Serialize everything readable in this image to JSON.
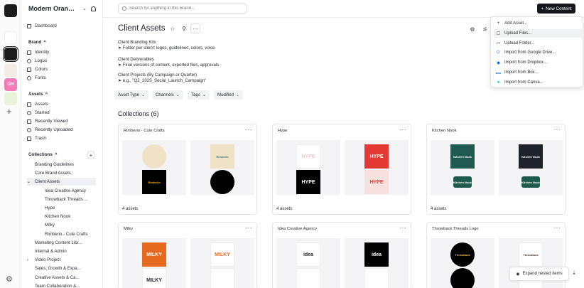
{
  "workspace": {
    "brand_name": "Modern Orange ...",
    "rail": [
      {
        "initials": "",
        "color": "#1c1c1c"
      },
      {
        "initials": "",
        "color": "#ffffff"
      },
      {
        "initials": "",
        "color": "#1c1c1c"
      },
      {
        "initials": "",
        "color": "#f2ede2"
      },
      {
        "initials": "GH",
        "color": "#f27cb8"
      },
      {
        "initials": "",
        "color": "#eaf3d8"
      }
    ]
  },
  "sidebar": {
    "dashboard": "Dashboard",
    "brand_header": "Brand",
    "brand_items": [
      "Identity",
      "Logos",
      "Colors",
      "Fonts"
    ],
    "assets_header": "Assets",
    "assets_items": [
      "Assets",
      "Starred",
      "Recently Viewed",
      "Recently Uploaded",
      "Trash"
    ],
    "collections_header": "Collections",
    "collections_items": [
      {
        "label": "Branding Guidelines"
      },
      {
        "label": "Core Brand Assets"
      },
      {
        "label": "Client Assets"
      },
      {
        "label": "Idea Creative Agency"
      },
      {
        "label": "Throwback Threads ..."
      },
      {
        "label": "Hype"
      },
      {
        "label": "Kitchen Nook"
      },
      {
        "label": "Milky"
      },
      {
        "label": "Rimberio - Cute Crafts"
      },
      {
        "label": "Marketing Content Libr..."
      },
      {
        "label": "Internal & Admin"
      },
      {
        "label": "Video Project"
      },
      {
        "label": "Sales, Growth & Expa..."
      },
      {
        "label": "Creative Assets & Ca..."
      },
      {
        "label": "Team Collaboration &..."
      }
    ]
  },
  "topbar": {
    "search_placeholder": "Search for anything in this Brand...",
    "new_content": "New Content"
  },
  "page": {
    "title": "Client Assets",
    "description": [
      "Client Branding Kits",
      "➤ Folder per client: logos, guidelines, colors, voice",
      "Client Deliverables",
      "➤ Final versions of content, exported files, approvals",
      "Client Projects (By Campaign or Quarter)",
      "➤ e.g., \"Q2_2025_Social_Launch_Campaign\""
    ],
    "filters": [
      "Asset Type",
      "Channels",
      "Tags",
      "Modified"
    ],
    "collections_title": "Collections (6)"
  },
  "collections": [
    {
      "name": "Rimberio - Cute Crafts",
      "count": "4 assets",
      "thumbs": [
        {
          "bg": "#f0e2c6",
          "fg": "#e0683a",
          "text": "",
          "shape": "circle"
        },
        {
          "bg": "#f0e2c6",
          "fg": "#3f7f73",
          "text": "Rimberio",
          "shape": "rect"
        },
        {
          "bg": "#000000",
          "fg": "#f5b400",
          "text": "Rimberio",
          "shape": "rect"
        },
        {
          "bg": "#000000",
          "fg": "#f15a24",
          "text": "",
          "shape": "circle"
        }
      ]
    },
    {
      "name": "Hype",
      "count": "4 assets",
      "thumbs": [
        {
          "bg": "#ffffff",
          "fg": "#f3c7c7",
          "text": "HYPE",
          "shape": "rect"
        },
        {
          "bg": "#e53935",
          "fg": "#ffffff",
          "text": "HYPE",
          "shape": "rect"
        },
        {
          "bg": "#000000",
          "fg": "#ffffff",
          "text": "HYPE",
          "shape": "rect"
        },
        {
          "bg": "#f6e1de",
          "fg": "#e53935",
          "text": "HYPE",
          "shape": "rect"
        }
      ]
    },
    {
      "name": "Kitchen Nook",
      "count": "4 assets",
      "thumbs": [
        {
          "bg": "#1e5a4e",
          "fg": "#ffffff",
          "text": "Kitchen Nook",
          "shape": "rect"
        },
        {
          "bg": "#1f2329",
          "fg": "#ffffff",
          "text": "Kitchen Nook",
          "shape": "rect"
        },
        {
          "bg": "#ffffff",
          "fg": "#1e5a4e",
          "text": "Kitchen Nook",
          "shape": "tag"
        },
        {
          "bg": "#ffffff",
          "fg": "#1e5a4e",
          "text": "Kitchen Nook",
          "shape": "tag"
        }
      ]
    },
    {
      "name": "Milky",
      "count": "",
      "thumbs": [
        {
          "bg": "#e56a1f",
          "fg": "#ffffff",
          "text": "MILKY",
          "shape": "rect"
        },
        {
          "bg": "#ffffff",
          "fg": "#e56a1f",
          "text": "MILKY",
          "shape": "rect"
        },
        {
          "bg": "#ffffff",
          "fg": "#1f2329",
          "text": "MILKY",
          "shape": "rect"
        },
        {
          "bg": "#ffffff",
          "fg": "#e56a1f",
          "text": "",
          "shape": "rect"
        }
      ]
    },
    {
      "name": "Idea Creative Agency",
      "count": "",
      "thumbs": [
        {
          "bg": "#ffffff",
          "fg": "#1f2329",
          "text": "idea",
          "shape": "rect"
        },
        {
          "bg": "#000000",
          "fg": "#ffffff",
          "text": "idea",
          "shape": "rect"
        },
        {
          "bg": "#ffffff",
          "fg": "#1f2329",
          "text": "",
          "shape": "rect"
        },
        {
          "bg": "#ffffff",
          "fg": "#1f2329",
          "text": "",
          "shape": "rect"
        }
      ]
    },
    {
      "name": "Throwback Threads Logo",
      "count": "",
      "thumbs": [
        {
          "bg": "#000000",
          "fg": "#f2c14e",
          "text": "Throwback",
          "shape": "circle"
        },
        {
          "bg": "#ffffff",
          "fg": "#3b2a1a",
          "text": "Throwback",
          "shape": "rect"
        },
        {
          "bg": "#000000",
          "fg": "#ffffff",
          "text": "",
          "shape": "circle"
        },
        {
          "bg": "#ffffff",
          "fg": "#3b2a1a",
          "text": "",
          "shape": "rect"
        }
      ]
    }
  ],
  "menu": {
    "items": [
      {
        "icon": "+",
        "label": "Add Asset..."
      },
      {
        "icon": "▢",
        "label": "Upload Files..."
      },
      {
        "icon": "▭",
        "label": "Upload Folder..."
      },
      {
        "icon": "G",
        "label": "Import from Google Drive..."
      },
      {
        "icon": "◆",
        "label": "Import from Dropbox..."
      },
      {
        "icon": "box",
        "label": "Import from Box..."
      },
      {
        "icon": "●",
        "label": "Import from Canva..."
      }
    ]
  },
  "footer": {
    "expand": "Expand nested items"
  }
}
